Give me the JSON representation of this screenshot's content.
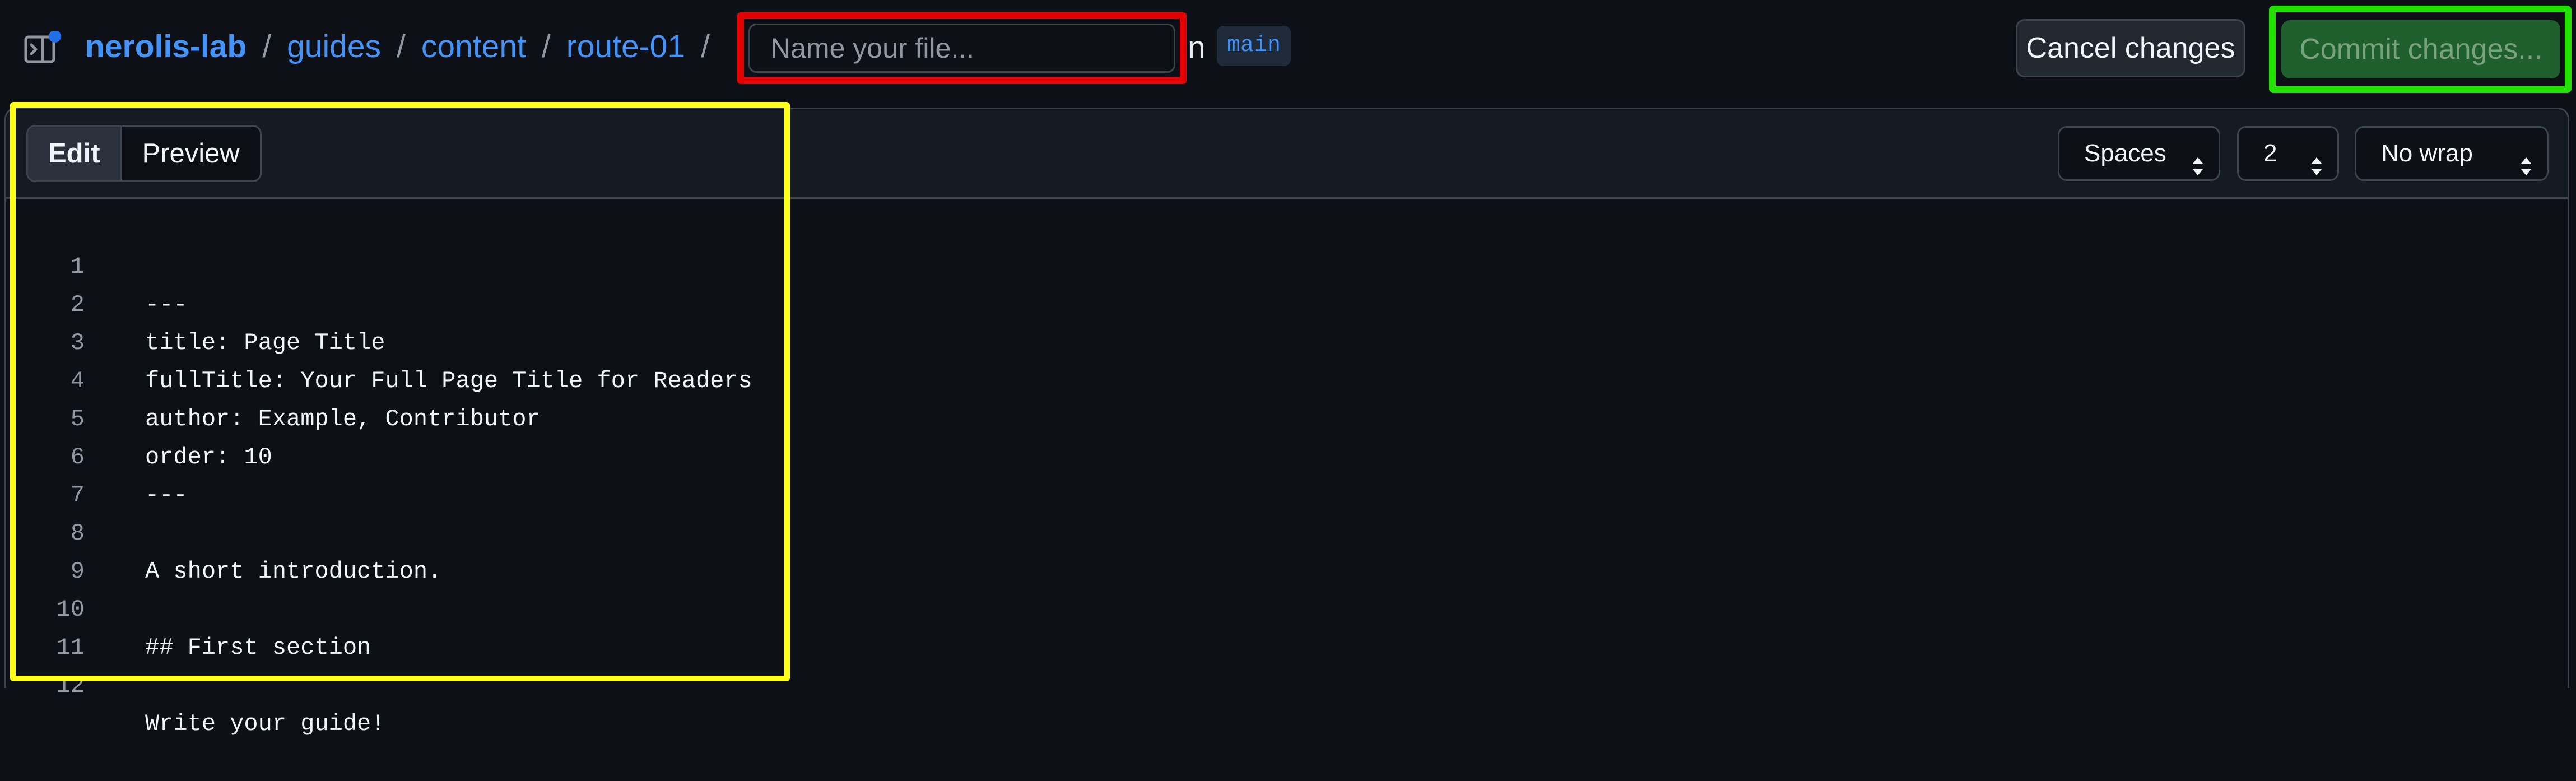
{
  "breadcrumb": {
    "repo": "nerolis-lab",
    "path": [
      "guides",
      "content",
      "route-01"
    ],
    "separator": "/"
  },
  "filename": {
    "placeholder": "Name your file...",
    "value": ""
  },
  "branch": {
    "prefix": "n",
    "name": "main"
  },
  "actions": {
    "cancel_label": "Cancel changes",
    "commit_label": "Commit changes..."
  },
  "editor": {
    "tabs": [
      "Edit",
      "Preview"
    ],
    "active_tab": "Edit",
    "indent_mode": "Spaces",
    "indent_size": "2",
    "wrap_mode": "No wrap",
    "lines": [
      {
        "num": "1",
        "text": "---"
      },
      {
        "num": "2",
        "text": "title: Page Title"
      },
      {
        "num": "3",
        "text": "fullTitle: Your Full Page Title for Readers"
      },
      {
        "num": "4",
        "text": "author: Example, Contributor"
      },
      {
        "num": "5",
        "text": "order: 10"
      },
      {
        "num": "6",
        "text": "---"
      },
      {
        "num": "7",
        "text": ""
      },
      {
        "num": "8",
        "text": "A short introduction."
      },
      {
        "num": "9",
        "text": ""
      },
      {
        "num": "10",
        "text": "## First section"
      },
      {
        "num": "11",
        "text": ""
      },
      {
        "num": "12",
        "text": "Write your guide!"
      }
    ]
  },
  "icons": {
    "sidebar_toggle": "sidebar-expand-icon",
    "select_arrows": "chevron-updown-icon"
  },
  "colors": {
    "background": "#0d1117",
    "link": "#4493f8",
    "commit_button": "#1e5f2d",
    "filename_highlight": "#e50000",
    "commit_highlight": "#22e000",
    "editor_highlight": "#ffff1a"
  }
}
